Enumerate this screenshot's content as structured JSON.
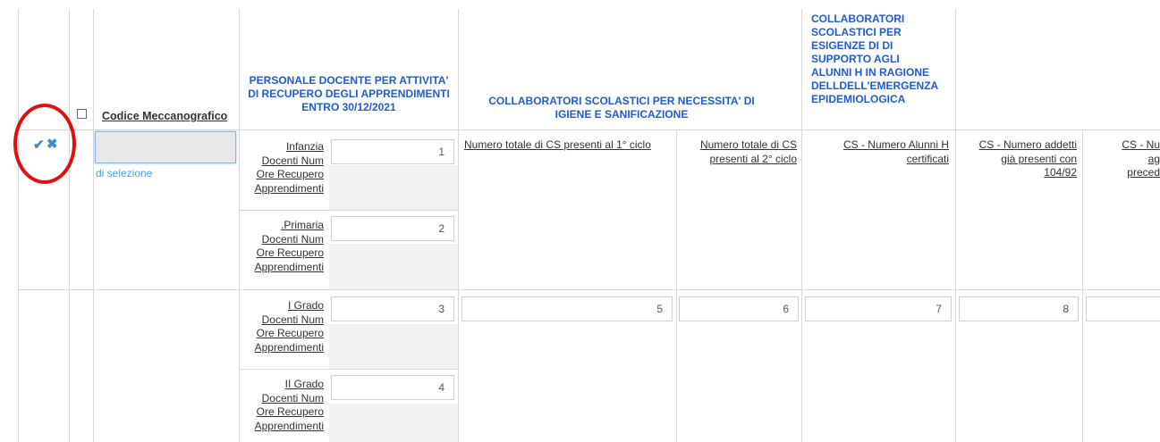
{
  "header": {
    "codice_label": "Codice Meccanografico",
    "col_personale": "PERSONALE DOCENTE PER ATTIVITA' DI RECUPERO DEGLI APPRENDIMENTI ENTRO 30/12/2021",
    "col_igiene": "COLLABORATORI SCOLASTICI PER NECESSITA' DI IGIENE E SANIFICAZIONE",
    "col_supporto_lines": [
      "COLLABORATORI",
      "SCOLASTICI PER",
      "ESIGENZE DI DI",
      "SUPPORTO AGLI",
      "ALUNNI H IN RAGIONE",
      "DELLDELL'EMERGENZA",
      "EPIDEMIOLOGICA"
    ]
  },
  "row": {
    "code_value": "",
    "hint_text": "di selezione"
  },
  "levels": [
    {
      "lines": [
        "Infanzia",
        "Docenti Num",
        "Ore Recupero",
        "Apprendimenti"
      ],
      "value": "1"
    },
    {
      "lines": [
        ".Primaria",
        "Docenti Num",
        "Ore Recupero",
        "Apprendimenti"
      ],
      "value": "2"
    },
    {
      "lines": [
        "I Grado",
        "Docenti Num",
        "Ore Recupero",
        "Apprendimenti"
      ],
      "value": "3"
    },
    {
      "lines": [
        "II Grado",
        "Docenti Num",
        "Ore Recupero",
        "Apprendimenti"
      ],
      "value": "4"
    }
  ],
  "cs_headers": {
    "cs1": "Numero totale di CS presenti al 1° ciclo",
    "cs2_lines": [
      "Numero totale di CS",
      "presenti al 2° ciclo"
    ],
    "cs3_lines": [
      "CS - Numero Alunni H",
      "certificati"
    ],
    "cs4_lines": [
      "CS - Numero addetti",
      "già presenti con",
      "104/92"
    ],
    "cs5_lines": [
      "CS - Nu",
      "ag",
      "preced"
    ]
  },
  "cs_values": [
    "5",
    "6",
    "7",
    "8",
    ""
  ],
  "icons": {
    "confirm": "check-icon",
    "cancel": "close-icon",
    "confirm_glyph": "✔",
    "cancel_glyph": "✖"
  }
}
